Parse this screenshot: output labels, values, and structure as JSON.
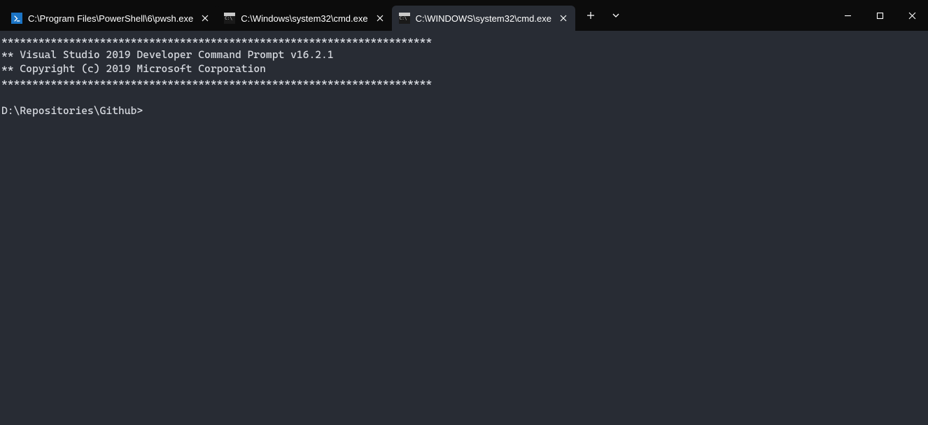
{
  "tabs": [
    {
      "title": "C:\\Program Files\\PowerShell\\6\\pwsh.exe",
      "icon": "powershell",
      "active": false
    },
    {
      "title": "C:\\Windows\\system32\\cmd.exe",
      "icon": "cmd",
      "active": false
    },
    {
      "title": "C:\\WINDOWS\\system32\\cmd.exe",
      "icon": "cmd",
      "active": true
    }
  ],
  "terminal": {
    "lines": [
      "**********************************************************************",
      "** Visual Studio 2019 Developer Command Prompt v16.2.1",
      "** Copyright (c) 2019 Microsoft Corporation",
      "**********************************************************************",
      "",
      "D:\\Repositories\\Github>"
    ]
  }
}
